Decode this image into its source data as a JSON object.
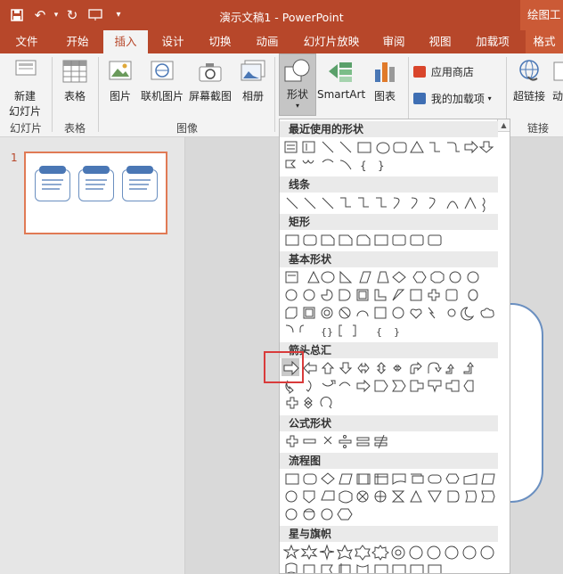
{
  "titlebar": {
    "qat": [
      "save-icon",
      "undo-icon",
      "redo-icon",
      "present-icon",
      "customize-icon"
    ],
    "doc_title": "演示文稿1 - PowerPoint",
    "context_title": "绘图工"
  },
  "tabs": [
    "文件",
    "开始",
    "插入",
    "设计",
    "切换",
    "动画",
    "幻灯片放映",
    "审阅",
    "视图",
    "加载项",
    "格式"
  ],
  "active_tab": "插入",
  "ribbon": {
    "new_slide": "新建",
    "new_slide2": "幻灯片",
    "table": "表格",
    "picture": "图片",
    "online_picture": "联机图片",
    "screenshot": "屏幕截图",
    "album": "相册",
    "shapes": "形状",
    "smartart": "SmartArt",
    "chart": "图表",
    "app_store": "应用商店",
    "my_addins": "我的加载项",
    "hyperlink": "超链接",
    "action": "动",
    "group_slides": "幻灯片",
    "group_tables": "表格",
    "group_images": "图像",
    "group_links": "链接"
  },
  "slides_pane": {
    "slide_number": "1"
  },
  "shapes_gallery": {
    "categories": [
      "最近使用的形状",
      "线条",
      "矩形",
      "基本形状",
      "箭头总汇",
      "公式形状",
      "流程图",
      "星与旗帜"
    ]
  },
  "colors": {
    "accent": "#b7472a",
    "context": "#cb5a36",
    "highlight": "#d93b3b"
  }
}
